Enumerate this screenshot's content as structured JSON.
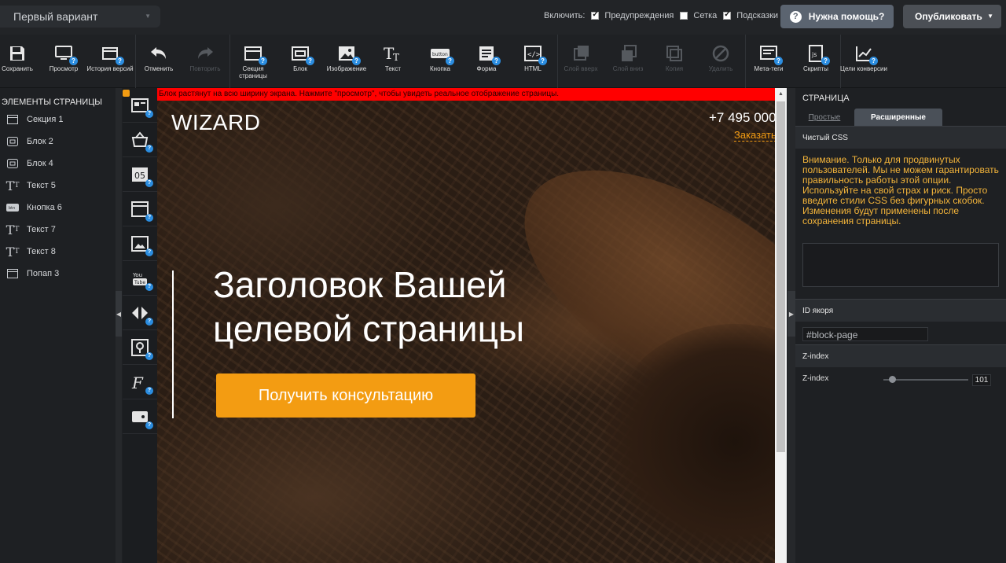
{
  "topbar": {
    "variant": "Первый вариант",
    "include_label": "Включить:",
    "options": [
      {
        "label": "Предупреждения",
        "checked": true
      },
      {
        "label": "Сетка",
        "checked": false
      },
      {
        "label": "Подсказки",
        "checked": true
      }
    ],
    "help_label": "Нужна помощь?",
    "publish_label": "Опубликовать"
  },
  "toolbar": {
    "save": "Сохранить",
    "preview": "Просмотр",
    "history": "История версий",
    "undo": "Отменить",
    "redo": "Повторить",
    "section": "Секция страницы",
    "block": "Блок",
    "image": "Изображение",
    "text": "Текст",
    "button": "Кнопка",
    "form": "Форма",
    "html": "HTML",
    "layer_up": "Слой вверх",
    "layer_down": "Слой вниз",
    "copy": "Копия",
    "delete": "Удалить",
    "meta": "Мета-теги",
    "scripts": "Скрипты",
    "goals": "Цели конверсии"
  },
  "left_panel": {
    "title": "ЭЛЕМЕНТЫ СТРАНИЦЫ",
    "items": [
      {
        "label": "Секция 1",
        "icon": "section-icon"
      },
      {
        "label": "Блок 2",
        "icon": "block-icon"
      },
      {
        "label": "Блок 4",
        "icon": "block-icon"
      },
      {
        "label": "Текст 5",
        "icon": "text-icon"
      },
      {
        "label": "Кнопка 6",
        "icon": "button-icon"
      },
      {
        "label": "Текст 7",
        "icon": "text-icon"
      },
      {
        "label": "Текст 8",
        "icon": "text-icon"
      },
      {
        "label": "Попап 3",
        "icon": "section-icon"
      }
    ]
  },
  "canvas": {
    "notice": "Блок растянут на всю ширину экрана. Нажмите \"просмотр\", чтобы увидеть реальное отображение страницы.",
    "brand": "WIZARD",
    "phone": "+7 495 000",
    "order": "Заказать",
    "title_line1": "Заголовок Вашей",
    "title_line2": "целевой страницы",
    "cta": "Получить консультацию"
  },
  "right_panel": {
    "title": "СТРАНИЦА",
    "tab_simple": "Простые",
    "tab_advanced": "Расширенные",
    "css_section": "Чистый CSS",
    "warning": "Внимание. Только для продвинутых пользователей. Мы не можем гарантировать правильность работы этой опции. Используйте на свой страх и риск. Просто введите стили CSS без фигурных скобок. Изменения будут применены после сохранения страницы.",
    "anchor_section": "ID якоря",
    "anchor_value": "#block-page",
    "z_section": "Z-index",
    "z_label": "Z-index",
    "z_value": "101"
  },
  "colors": {
    "accent": "#f39c12",
    "notice_bg": "#ff0000",
    "help_badge": "#2b8de0",
    "warning_text": "#f3b43a"
  }
}
